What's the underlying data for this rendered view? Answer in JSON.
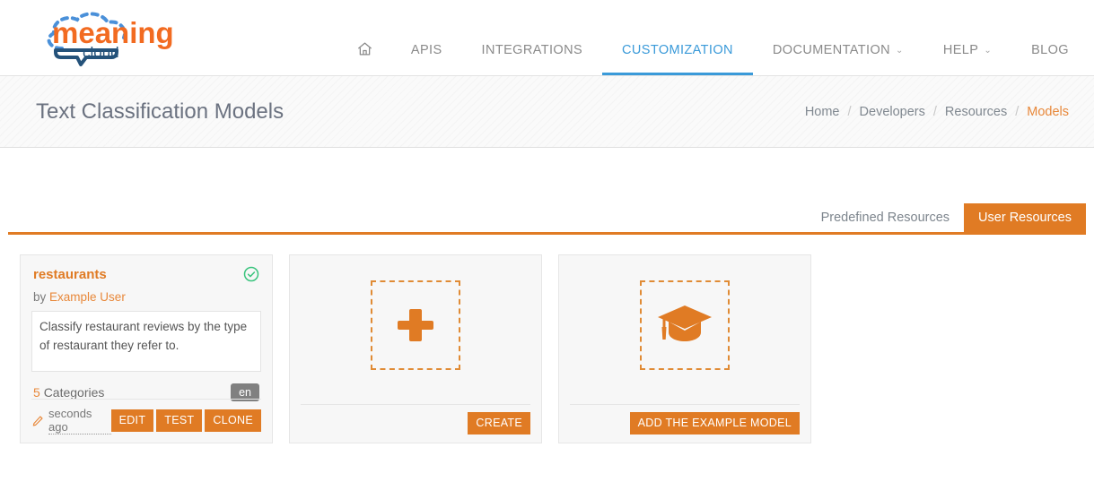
{
  "brand": {
    "name_part1": "meaning",
    "name_part2": "cloud",
    "orange": "#f26b21",
    "navy": "#24527a",
    "blue": "#4a90d9"
  },
  "nav": {
    "home_icon": "home-icon",
    "items": [
      {
        "label": "APIS",
        "active": false,
        "caret": ""
      },
      {
        "label": "INTEGRATIONS",
        "active": false,
        "caret": ""
      },
      {
        "label": "CUSTOMIZATION",
        "active": true,
        "caret": ""
      },
      {
        "label": "DOCUMENTATION",
        "active": false,
        "caret": "⌄"
      },
      {
        "label": "HELP",
        "active": false,
        "caret": "⌄"
      },
      {
        "label": "BLOG",
        "active": false,
        "caret": ""
      }
    ]
  },
  "header": {
    "title": "Text Classification Models",
    "breadcrumb": [
      {
        "label": "Home",
        "current": false
      },
      {
        "label": "Developers",
        "current": false
      },
      {
        "label": "Resources",
        "current": false
      },
      {
        "label": "Models",
        "current": true
      }
    ],
    "separator": "/"
  },
  "tabs": [
    {
      "label": "Predefined Resources",
      "active": false
    },
    {
      "label": "User Resources",
      "active": true
    }
  ],
  "model_card": {
    "title": "restaurants",
    "status_icon": "check-circle-icon",
    "by_prefix": "by",
    "author": "Example User",
    "description": "Classify restaurant reviews by the type of restaurant they refer to.",
    "categories_count": "5",
    "categories_label": "Categories",
    "language": "en",
    "timestamp_icon": "pencil-icon",
    "timestamp": "seconds ago",
    "buttons": [
      {
        "label": "EDIT"
      },
      {
        "label": "TEST"
      },
      {
        "label": "CLONE"
      }
    ]
  },
  "create_card": {
    "icon": "plus-icon",
    "button_label": "CREATE"
  },
  "example_card": {
    "icon": "graduation-cap-icon",
    "button_label": "ADD THE EXAMPLE MODEL"
  },
  "colors": {
    "accent_orange": "#e07b24",
    "active_blue": "#3a9ad9",
    "success_green": "#3ac47d",
    "badge_gray": "#808080"
  }
}
